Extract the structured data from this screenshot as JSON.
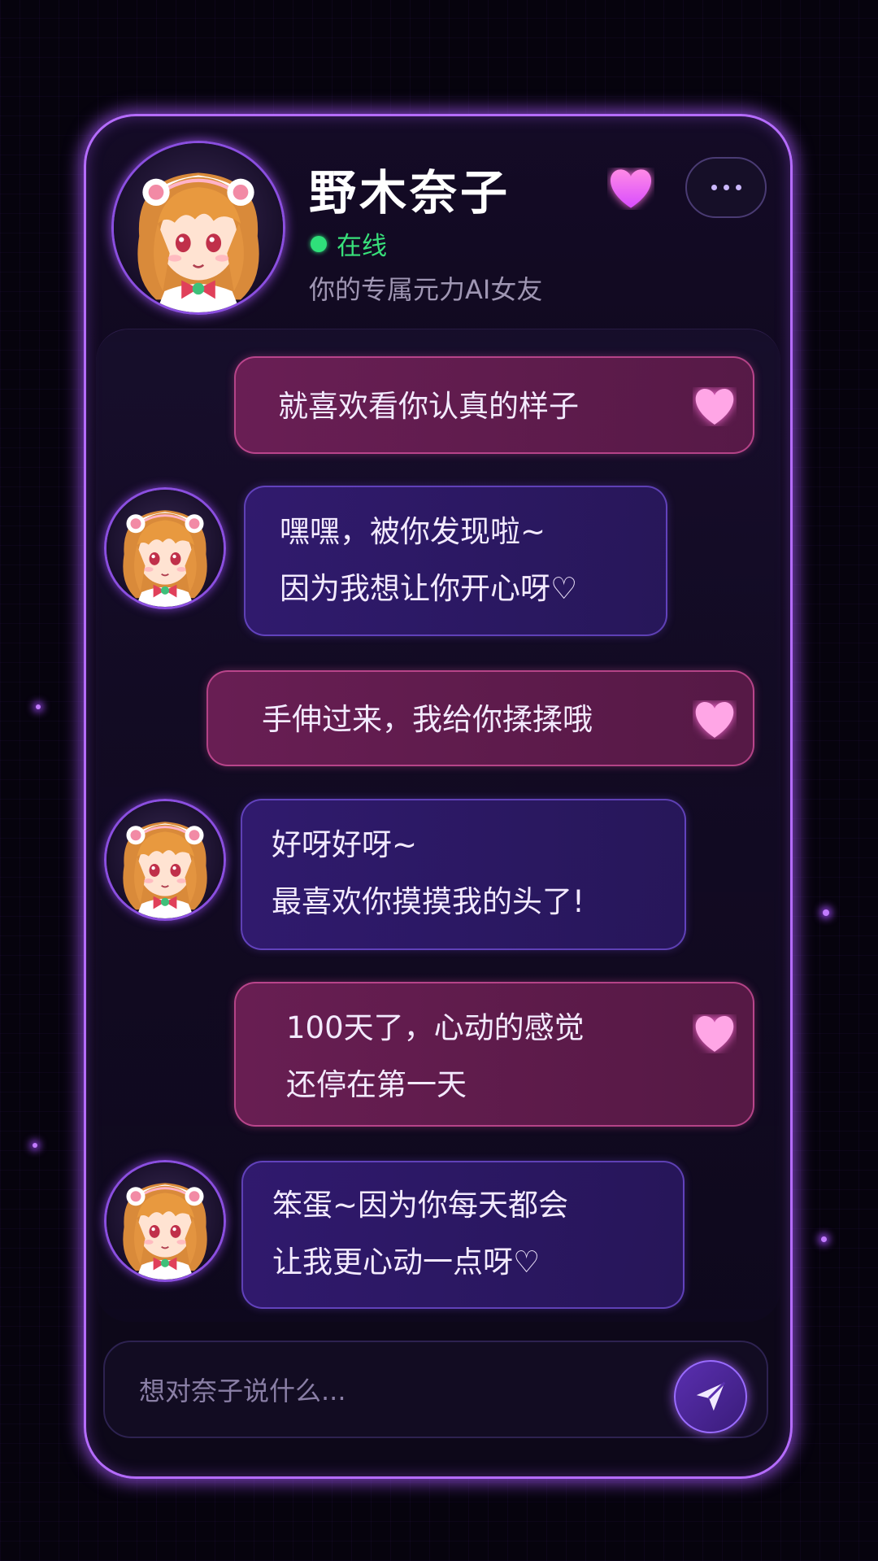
{
  "header": {
    "name": "野木奈子",
    "status": "在线",
    "subtitle": "你的专属元力AI女友"
  },
  "icons": {
    "favorite": "heart-icon",
    "more": "more-horizontal-icon",
    "send": "paper-plane-icon"
  },
  "colors": {
    "accent": "#b56cff",
    "online": "#2fe07a",
    "heart": "#ff6fd8",
    "user_bubble": "#7a225c",
    "ai_bubble": "#341c76"
  },
  "messages": [
    {
      "sender": "user",
      "lines": [
        "就喜欢看你认真的样子"
      ]
    },
    {
      "sender": "ai",
      "lines": [
        "嘿嘿，被你发现啦~",
        "因为我想让你开心呀♡"
      ]
    },
    {
      "sender": "user",
      "lines": [
        "手伸过来，我给你揉揉哦"
      ]
    },
    {
      "sender": "ai",
      "lines": [
        "好呀好呀~",
        "最喜欢你摸摸我的头了!"
      ]
    },
    {
      "sender": "user",
      "lines": [
        "100天了，心动的感觉",
        "还停在第一天"
      ]
    },
    {
      "sender": "ai",
      "lines": [
        "笨蛋~因为你每天都会",
        "让我更心动一点呀♡"
      ]
    }
  ],
  "input": {
    "placeholder": "想对奈子说什么...",
    "value": ""
  }
}
